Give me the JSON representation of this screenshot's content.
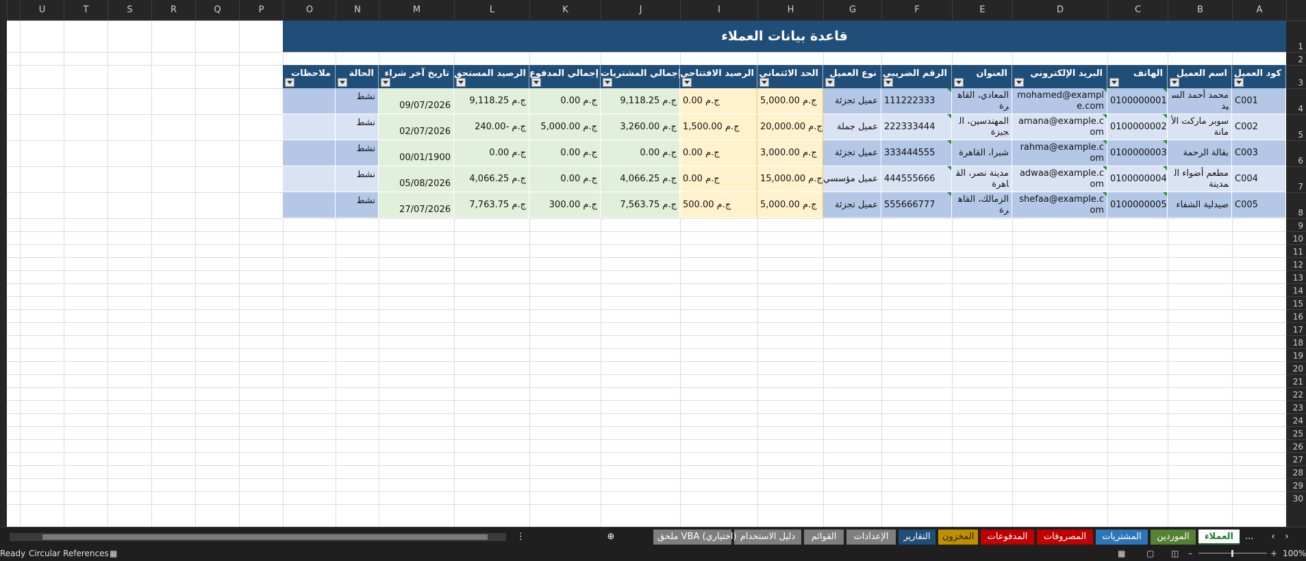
{
  "columns": [
    "A",
    "B",
    "C",
    "D",
    "E",
    "F",
    "G",
    "H",
    "I",
    "J",
    "K",
    "L",
    "M",
    "N",
    "O",
    "P",
    "Q",
    "R",
    "S",
    "T",
    "U"
  ],
  "rows": [
    "1",
    "2",
    "3",
    "4",
    "5",
    "6",
    "7",
    "8",
    "9",
    "10",
    "11",
    "12",
    "13",
    "14",
    "15",
    "16",
    "17",
    "18",
    "19",
    "20",
    "21",
    "22",
    "23",
    "24",
    "25",
    "26",
    "27",
    "28",
    "29",
    "30"
  ],
  "title": "قاعدة بيانات العملاء",
  "headers": [
    "كود العميل",
    "اسم العميل",
    "الهاتف",
    "البريد الإلكتروني",
    "العنوان",
    "الرقم الضريبي",
    "نوع العميل",
    "الحد الائتماني",
    "الرصيد الافتتاحي",
    "إجمالي المشتريات",
    "إجمالي المدفوع",
    "الرصيد المستحق",
    "تاريخ آخر شراء",
    "الحالة",
    "ملاحظات"
  ],
  "customers": [
    {
      "code": "C001",
      "name": "محمد أحمد السيد",
      "phone": "0100000001",
      "email": "mohamed@example.com",
      "address": "المعادي، القاهرة",
      "tax": "111222333",
      "type": "عميل تجزئة",
      "credit": "ج.م 5,000.00",
      "opening": "ج.م 0.00",
      "purchases": "ج.م 9,118.25",
      "paid": "ج.م 0.00",
      "due": "ج.م 9,118.25",
      "last_date": "09/07/2026",
      "status": "نشط"
    },
    {
      "code": "C002",
      "name": "سوبر ماركت الأمانة",
      "phone": "0100000002",
      "email": "amana@example.com",
      "address": "المهندسين، الجيزة",
      "tax": "222333444",
      "type": "عميل جملة",
      "credit": "ج.م 20,000.00",
      "opening": "ج.م 1,500.00",
      "purchases": "ج.م 3,260.00",
      "paid": "ج.م 5,000.00",
      "due": "ج.م -240.00",
      "last_date": "02/07/2026",
      "status": "نشط"
    },
    {
      "code": "C003",
      "name": "بقالة الرحمة",
      "phone": "0100000003",
      "email": "rahma@example.com",
      "address": "شبرا، القاهرة",
      "tax": "333444555",
      "type": "عميل تجزئة",
      "credit": "ج.م 3,000.00",
      "opening": "ج.م 0.00",
      "purchases": "ج.م 0.00",
      "paid": "ج.م 0.00",
      "due": "ج.م 0.00",
      "last_date": "00/01/1900",
      "status": "نشط"
    },
    {
      "code": "C004",
      "name": "مطعم أضواء المدينة",
      "phone": "0100000004",
      "email": "adwaa@example.com",
      "address": "مدينة نصر، القاهرة",
      "tax": "444555666",
      "type": "عميل مؤسسي",
      "credit": "ج.م 15,000.00",
      "opening": "ج.م 0.00",
      "purchases": "ج.م 4,066.25",
      "paid": "ج.م 0.00",
      "due": "ج.م 4,066.25",
      "last_date": "05/08/2026",
      "status": "نشط"
    },
    {
      "code": "C005",
      "name": "صيدلية الشفاء",
      "phone": "0100000005",
      "email": "shefaa@example.com",
      "address": "الزمالك، القاهرة",
      "tax": "555666777",
      "type": "عميل تجزئة",
      "credit": "ج.م 5,000.00",
      "opening": "ج.م 500.00",
      "purchases": "ج.م 7,563.75",
      "paid": "ج.م 300.00",
      "due": "ج.م 7,763.75",
      "last_date": "27/07/2026",
      "status": "نشط"
    }
  ],
  "tabs": [
    {
      "label": "...",
      "color": "#1f1f1f"
    },
    {
      "label": "العملاء",
      "color": "#ffffff",
      "active": true
    },
    {
      "label": "الموردين",
      "color": "#548235"
    },
    {
      "label": "المشتريات",
      "color": "#2e75b6"
    },
    {
      "label": "المصروفات",
      "color": "#c00000"
    },
    {
      "label": "المدفوعات",
      "color": "#c00000"
    },
    {
      "label": "المخزون",
      "color": "#bf8f00"
    },
    {
      "label": "التقارير",
      "color": "#1f4e79"
    },
    {
      "label": "الإعدادات",
      "color": "#7f7f7f"
    },
    {
      "label": "القوائم",
      "color": "#7f7f7f"
    },
    {
      "label": "دليل الاستخدام",
      "color": "#7f7f7f"
    },
    {
      "label": "ملحق VBA (اختياري)",
      "color": "#7f7f7f"
    }
  ],
  "status": {
    "ready": "Ready",
    "circular": "Circular References",
    "zoom": "100%"
  },
  "colors": {
    "header": "#1f4e79",
    "blue_cell": "#b4c7e7",
    "blue_cell_alt": "#dae3f3",
    "green_cell": "#e2efda",
    "yellow_cell": "#fff2cc"
  }
}
